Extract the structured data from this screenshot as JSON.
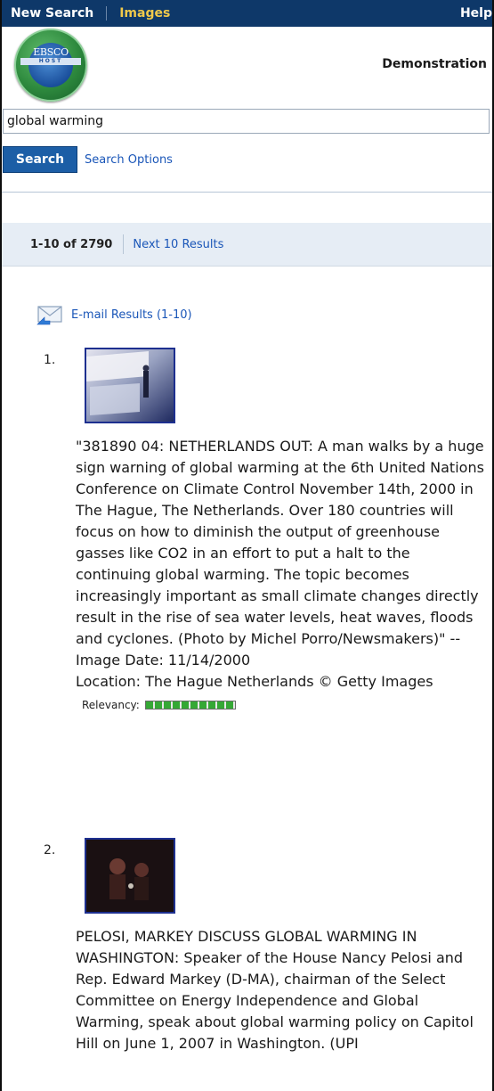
{
  "topbar": {
    "new_search": "New Search",
    "images": "Images",
    "help": "Help"
  },
  "header": {
    "logo_top": "EBSCO",
    "logo_sub": "HOST",
    "org_name": "Demonstration"
  },
  "search": {
    "value": "global warming",
    "button_label": "Search",
    "options_label": "Search Options"
  },
  "results_bar": {
    "count": "1-10 of 2790",
    "next_label": "Next 10 Results"
  },
  "email": {
    "label": "E-mail Results (1-10)"
  },
  "results": [
    {
      "number": "1.",
      "description": "\"381890 04: NETHERLANDS OUT: A man walks by a huge sign warning of global warming at the 6th United Nations Conference on Climate Control November 14th, 2000 in The Hague, The Netherlands. Over 180 countries will focus on how to diminish the output of greenhouse gasses like CO2 in an effort to put a halt to the continuing global warming. The topic becomes increasingly important as small climate changes directly result in the rise of sea water levels, heat waves, floods and cyclones. (Photo by Michel Porro/Newsmakers)\" -- Image Date: 11/14/2000",
      "location": "Location: The Hague Netherlands © Getty Images",
      "relevancy_label": "Relevancy:",
      "relevancy": 1.0
    },
    {
      "number": "2.",
      "description": "PELOSI, MARKEY DISCUSS GLOBAL WARMING IN WASHINGTON: Speaker of the House Nancy Pelosi and Rep. Edward Markey (D-MA), chairman of the Select Committee on Energy Independence and Global Warming, speak about global warming policy on Capitol Hill on June 1, 2007 in Washington. (UPI"
    }
  ],
  "icons": {
    "email": "envelope-arrow-icon",
    "logo": "ebsco-host-logo"
  },
  "colors": {
    "topbar_bg": "#0e3869",
    "images_tab": "#f0c94a",
    "link": "#1a56b8",
    "search_button": "#1c5ea6",
    "relevancy": "#35a835"
  }
}
